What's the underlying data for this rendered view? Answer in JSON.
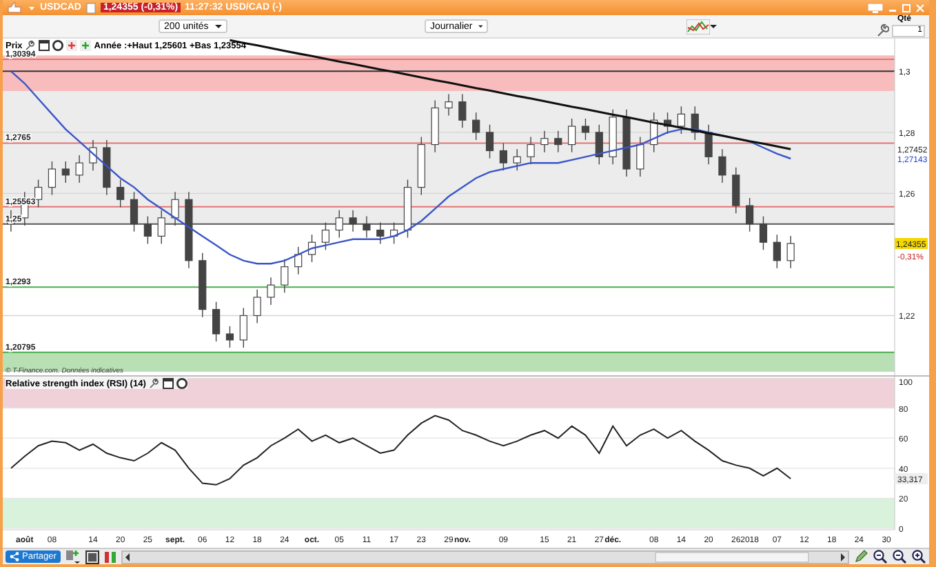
{
  "title_bar": {
    "symbol": "USDCAD",
    "quote": "1,24355 (-0,31%)",
    "status": "11:27:32 USD/CAD (-)"
  },
  "toolbar": {
    "period_size": "200 unités",
    "interval": "Journalier",
    "quantity_label": "Qté",
    "quantity": "1"
  },
  "price_panel": {
    "label": "Prix",
    "summary": "Année :+Haut 1,25601 +Bas 1,23554",
    "source": "© T-Finance.com. Données indicatives",
    "chart_data": {
      "type": "candlestick",
      "grid": true,
      "ylim": [
        1.2,
        1.3107
      ],
      "yticks": [
        {
          "value": 1.22,
          "label": "1,22"
        },
        {
          "value": 1.26,
          "label": "1,26"
        },
        {
          "value": 1.28,
          "label": "1,28"
        },
        {
          "value": 1.3,
          "label": "1,3"
        }
      ],
      "ohlc": [
        [
          1.25,
          1.2545,
          1.2475,
          1.252
        ],
        [
          1.252,
          1.2605,
          1.2495,
          1.258
        ],
        [
          1.258,
          1.2645,
          1.2555,
          1.262
        ],
        [
          1.262,
          1.2705,
          1.2595,
          1.268
        ],
        [
          1.268,
          1.2705,
          1.2635,
          1.266
        ],
        [
          1.266,
          1.2725,
          1.2635,
          1.27
        ],
        [
          1.27,
          1.2775,
          1.2675,
          1.275
        ],
        [
          1.275,
          1.2775,
          1.2595,
          1.262
        ],
        [
          1.262,
          1.2645,
          1.2555,
          1.258
        ],
        [
          1.258,
          1.2605,
          1.2475,
          1.25
        ],
        [
          1.25,
          1.2525,
          1.2435,
          1.246
        ],
        [
          1.246,
          1.2545,
          1.2435,
          1.252
        ],
        [
          1.252,
          1.2605,
          1.2495,
          1.258
        ],
        [
          1.258,
          1.2605,
          1.2355,
          1.238
        ],
        [
          1.238,
          1.2405,
          1.2195,
          1.222
        ],
        [
          1.222,
          1.2245,
          1.2115,
          1.214
        ],
        [
          1.214,
          1.2165,
          1.2095,
          1.212
        ],
        [
          1.212,
          1.2225,
          1.2095,
          1.22
        ],
        [
          1.22,
          1.2285,
          1.2175,
          1.226
        ],
        [
          1.226,
          1.2325,
          1.2235,
          1.23
        ],
        [
          1.23,
          1.2385,
          1.2275,
          1.236
        ],
        [
          1.236,
          1.2425,
          1.2335,
          1.24
        ],
        [
          1.24,
          1.2465,
          1.2375,
          1.244
        ],
        [
          1.244,
          1.2505,
          1.2415,
          1.248
        ],
        [
          1.248,
          1.2545,
          1.2455,
          1.252
        ],
        [
          1.252,
          1.2545,
          1.2475,
          1.25
        ],
        [
          1.25,
          1.2525,
          1.2455,
          1.248
        ],
        [
          1.248,
          1.2505,
          1.2435,
          1.246
        ],
        [
          1.246,
          1.2505,
          1.2435,
          1.248
        ],
        [
          1.248,
          1.2645,
          1.2455,
          1.262
        ],
        [
          1.262,
          1.2785,
          1.2595,
          1.276
        ],
        [
          1.276,
          1.2905,
          1.2735,
          1.288
        ],
        [
          1.288,
          1.2925,
          1.2855,
          1.29
        ],
        [
          1.29,
          1.2925,
          1.2815,
          1.284
        ],
        [
          1.284,
          1.2865,
          1.2775,
          1.28
        ],
        [
          1.28,
          1.2825,
          1.2715,
          1.274
        ],
        [
          1.274,
          1.2765,
          1.2675,
          1.27
        ],
        [
          1.27,
          1.2745,
          1.2675,
          1.272
        ],
        [
          1.272,
          1.2785,
          1.2695,
          1.276
        ],
        [
          1.276,
          1.2805,
          1.2735,
          1.278
        ],
        [
          1.278,
          1.2805,
          1.2735,
          1.276
        ],
        [
          1.276,
          1.2845,
          1.2735,
          1.282
        ],
        [
          1.282,
          1.2845,
          1.2775,
          1.28
        ],
        [
          1.28,
          1.2825,
          1.2695,
          1.272
        ],
        [
          1.272,
          1.2875,
          1.2695,
          1.285
        ],
        [
          1.285,
          1.2875,
          1.2655,
          1.268
        ],
        [
          1.268,
          1.2785,
          1.2655,
          1.276
        ],
        [
          1.276,
          1.2865,
          1.2735,
          1.284
        ],
        [
          1.284,
          1.2865,
          1.2795,
          1.282
        ],
        [
          1.282,
          1.2885,
          1.2795,
          1.286
        ],
        [
          1.286,
          1.2885,
          1.2775,
          1.28
        ],
        [
          1.28,
          1.2825,
          1.2695,
          1.272
        ],
        [
          1.272,
          1.2745,
          1.2635,
          1.266
        ],
        [
          1.266,
          1.2685,
          1.2535,
          1.256
        ],
        [
          1.256,
          1.2585,
          1.2475,
          1.25
        ],
        [
          1.25,
          1.2525,
          1.2415,
          1.244
        ],
        [
          1.244,
          1.2465,
          1.2355,
          1.238
        ],
        [
          1.238,
          1.2461,
          1.2355,
          1.2436
        ],
        null,
        null,
        null,
        null,
        null,
        null,
        null
      ],
      "series": [
        {
          "type": "line",
          "color": "#3a55c8",
          "values": [
            1.3,
            1.296,
            1.291,
            1.286,
            1.281,
            1.277,
            1.273,
            1.269,
            1.265,
            1.262,
            1.258,
            1.255,
            1.252,
            1.249,
            1.246,
            1.243,
            1.24,
            1.238,
            1.237,
            1.237,
            1.238,
            1.24,
            1.242,
            1.243,
            1.244,
            1.245,
            1.245,
            1.245,
            1.246,
            1.248,
            1.251,
            1.255,
            1.259,
            1.262,
            1.265,
            1.267,
            1.268,
            1.269,
            1.27,
            1.27,
            1.27,
            1.271,
            1.272,
            1.273,
            1.274,
            1.275,
            1.276,
            1.278,
            1.28,
            1.281,
            1.281,
            1.28,
            1.279,
            1.278,
            1.277,
            1.275,
            1.273,
            1.2714,
            null,
            null,
            null,
            null,
            null,
            null,
            null
          ]
        },
        {
          "type": "line",
          "color": "#111111",
          "values": [
            null,
            null,
            null,
            null,
            null,
            null,
            null,
            null,
            null,
            null,
            null,
            null,
            null,
            null,
            null,
            null,
            1.3102,
            1.3093,
            1.3085,
            1.3076,
            1.3067,
            1.3058,
            1.305,
            1.3041,
            1.3032,
            1.3024,
            1.3015,
            1.3006,
            1.2998,
            1.2989,
            1.298,
            1.2971,
            1.2963,
            1.2954,
            1.2945,
            1.2937,
            1.2928,
            1.2919,
            1.2911,
            1.2902,
            1.2893,
            1.2884,
            1.2876,
            1.2867,
            1.2858,
            1.285,
            1.2841,
            1.2832,
            1.2824,
            1.2815,
            1.2806,
            1.2797,
            1.2789,
            1.278,
            1.2771,
            1.2763,
            1.2754,
            1.2745,
            null,
            null,
            null,
            null,
            null,
            null,
            null
          ]
        }
      ],
      "bands": [
        {
          "axis": "y",
          "from": 1.2935,
          "to": 1.3052,
          "color": "#f9bcbc"
        },
        {
          "axis": "y",
          "from": 1.2503,
          "to": 1.2935,
          "color": "#ececec"
        },
        {
          "axis": "y",
          "from": 1.2016,
          "to": 1.208,
          "color": "#b9e0b4"
        }
      ],
      "ref_lines": [
        {
          "axis": "y",
          "value": 1.30394,
          "label": "1,30394",
          "color": "#e57373"
        },
        {
          "axis": "y",
          "value": 1.3,
          "color": "#333333"
        },
        {
          "axis": "y",
          "value": 1.2765,
          "label": "1,2765",
          "color": "#e57373"
        },
        {
          "axis": "y",
          "value": 1.25563,
          "label": "1,25563",
          "color": "#e57373"
        },
        {
          "axis": "y",
          "value": 1.25,
          "label": "1,25",
          "color": "#555555"
        },
        {
          "axis": "y",
          "value": 1.2293,
          "label": "1,2293",
          "color": "#4cae4c"
        },
        {
          "axis": "y",
          "value": 1.20795,
          "label": "1,20795",
          "color": "#4cae4c"
        }
      ]
    },
    "markers": [
      {
        "kind": "line_value",
        "text": "1,27452",
        "color": "#222222"
      },
      {
        "kind": "line_value",
        "text": "1,27143",
        "color": "#2244cc"
      },
      {
        "kind": "price_badge",
        "text": "1,24355",
        "color": "#f5d800"
      },
      {
        "kind": "change",
        "text": "-0,31%",
        "color": "#cc2222"
      }
    ]
  },
  "rsi_panel": {
    "title": "Relative strength index (RSI) (14)",
    "marker": "33,317",
    "chart_data": {
      "type": "line",
      "grid": true,
      "ylim": [
        0,
        100
      ],
      "yticks": [
        0,
        20,
        40,
        60,
        80,
        100
      ],
      "categories": [
        null,
        "août",
        null,
        "08",
        null,
        null,
        "14",
        null,
        "20",
        null,
        "25",
        null,
        "sept.",
        null,
        "06",
        null,
        "12",
        null,
        "18",
        null,
        "24",
        null,
        "oct.",
        null,
        "05",
        null,
        "11",
        null,
        "17",
        null,
        "23",
        null,
        "29",
        "nov.",
        null,
        null,
        "09",
        null,
        null,
        "15",
        null,
        "21",
        null,
        "27",
        "déc.",
        null,
        null,
        "08",
        null,
        "14",
        null,
        "20",
        null,
        "26",
        "2018",
        null,
        "07",
        null,
        "12",
        null,
        "18",
        null,
        "24",
        null,
        "30"
      ],
      "series": [
        {
          "color": "#222222",
          "values": [
            40,
            48,
            55,
            58,
            57,
            52,
            56,
            50,
            47,
            45,
            50,
            57,
            52,
            40,
            30,
            29,
            33,
            42,
            47,
            55,
            60,
            66,
            58,
            62,
            57,
            60,
            55,
            50,
            52,
            62,
            70,
            75,
            72,
            65,
            62,
            58,
            55,
            58,
            62,
            65,
            60,
            68,
            62,
            50,
            68,
            55,
            62,
            66,
            60,
            65,
            58,
            52,
            45,
            42,
            40,
            35,
            40,
            33,
            null,
            null,
            null,
            null,
            null,
            null,
            null
          ]
        }
      ],
      "bands": [
        {
          "axis": "y",
          "from": 80,
          "to": 100,
          "color": "#f1d1d9"
        },
        {
          "axis": "y",
          "from": 0,
          "to": 20,
          "color": "#d9f2dc"
        }
      ]
    }
  },
  "bottom_bar": {
    "share_button": "Partager"
  }
}
